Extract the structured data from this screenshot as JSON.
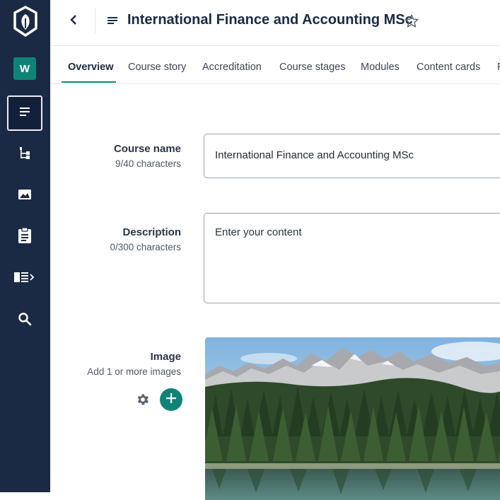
{
  "workspace": {
    "initial": "W"
  },
  "header": {
    "title": "International Finance and Accounting MSc"
  },
  "tabs": [
    {
      "label": "Overview",
      "active": true
    },
    {
      "label": "Course story"
    },
    {
      "label": "Accreditation"
    },
    {
      "label": "Course stages"
    },
    {
      "label": "Modules"
    },
    {
      "label": "Content cards"
    },
    {
      "label": "F"
    }
  ],
  "form": {
    "course_name": {
      "label": "Course name",
      "help": "9/40 characters",
      "value": "International Finance and Accounting MSc"
    },
    "description": {
      "label": "Description",
      "help": "0/300 characters",
      "placeholder": "Enter your content"
    },
    "image": {
      "label": "Image",
      "help": "Add 1 or more images"
    }
  },
  "colors": {
    "sidebar": "#1b2a44",
    "accent": "#0f8476"
  },
  "icons": [
    "logo-icon",
    "document-icon",
    "tree-icon",
    "image-icon",
    "clipboard-icon",
    "list-expand-icon",
    "search-icon",
    "back-icon",
    "star-icon",
    "gear-icon",
    "plus-icon"
  ]
}
